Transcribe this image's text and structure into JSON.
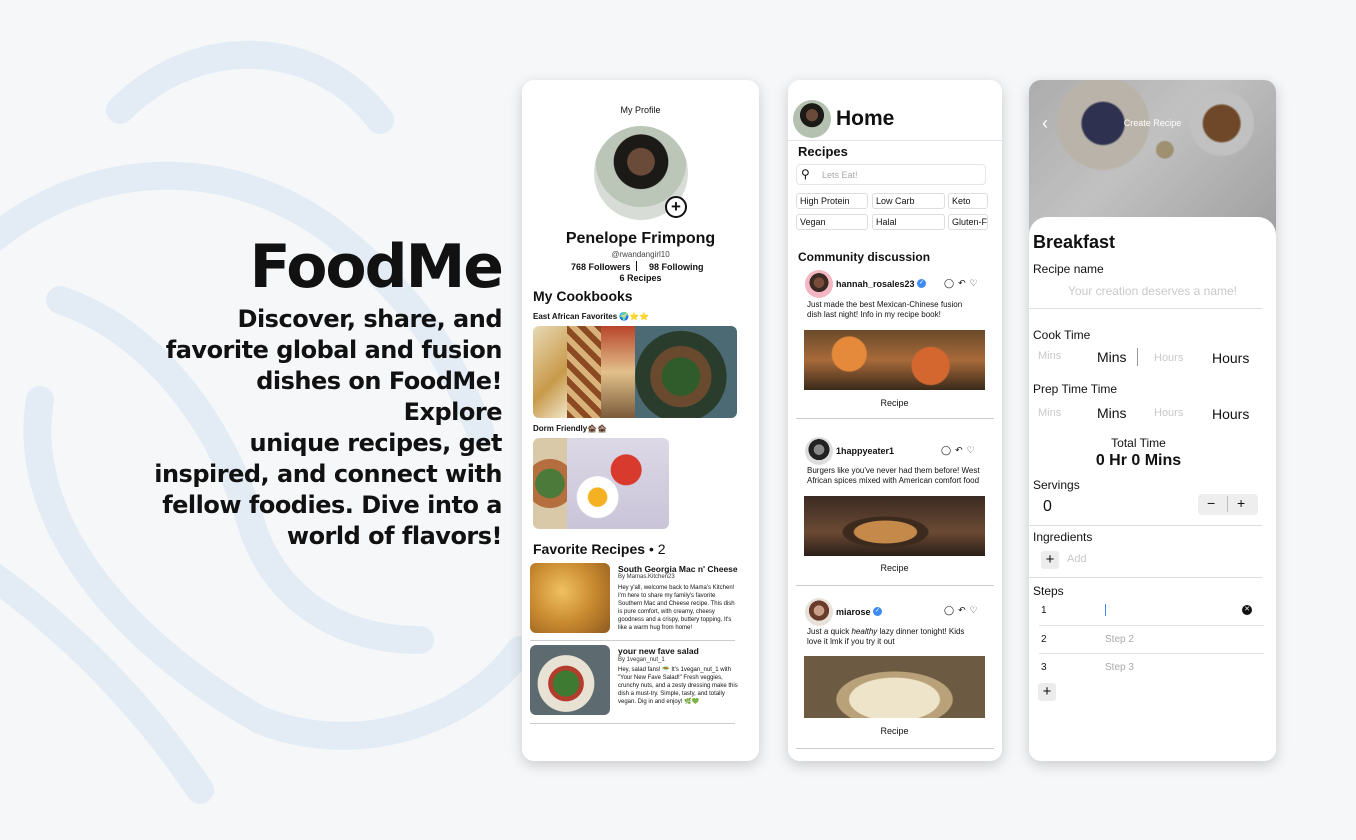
{
  "hero": {
    "title": "FoodMe",
    "tagline_lines": [
      "Discover, share, and",
      "favorite global and fusion",
      "dishes on FoodMe! Explore",
      "unique recipes, get",
      "inspired, and connect with",
      "fellow foodies. Dive into a",
      "world of flavors!"
    ]
  },
  "profile": {
    "header": "My Profile",
    "add_icon": "plus-circle-icon",
    "name": "Penelope Frimpong",
    "handle": "@rwandangirl10",
    "followers": "768 Followers",
    "following": "98 Following",
    "recipes": "6 Recipes",
    "cookbooks_title": "My Cookbooks",
    "cookbook_1": "East African Favorites 🌍⭐⭐",
    "cookbook_2": "Dorm Friendly🏚️🏚️",
    "favorites_title": "Favorite Recipes",
    "favorites_sep": "•",
    "favorites_count": "2",
    "fav_1": {
      "title": "South Georgia Mac n' Cheese",
      "author": "By Mamas.Kitchen23",
      "desc": "Hey y'all, welcome back to Mama's Kitchen! I'm here to share my family's favorite Southern Mac and Cheese recipe. This dish is pure comfort, with creamy, cheesy goodness and a crispy, buttery topping. It's like a warm hug from home!"
    },
    "fav_2": {
      "title": "your new fave salad",
      "author": "By 1vegan_nut_1",
      "desc": "Hey, salad fans! 🥗 It's 1vegan_nut_1 with \"Your New Fave Salad!\" Fresh veggies, crunchy nuts, and a zesty dressing make this dish a must-try. Simple, tasty, and totally vegan. Dig in and enjoy! 🌿💚"
    }
  },
  "home": {
    "title": "Home",
    "recipes_title": "Recipes",
    "search_placeholder": "Lets Eat!",
    "chips": [
      "High Protein",
      "Low Carb",
      "Keto",
      "Vegan",
      "Halal",
      "Gluten-F"
    ],
    "community_title": "Community discussion",
    "posts": [
      {
        "user": "hannah_rosales23",
        "verified": true,
        "text": "Just made the best Mexican-Chinese fusion dish last night! Info in my recipe book!",
        "button": "Recipe"
      },
      {
        "user": "1happyeater1",
        "verified": false,
        "text": "Burgers like you've never had them before! West African spices mixed with American comfort food",
        "button": "Recipe"
      },
      {
        "user": "miarose",
        "verified": true,
        "text_before": "Just a quick ",
        "text_em": "healthy",
        "text_after": " lazy dinner tonight! Kids love it lmk if you try it out",
        "button": "Recipe"
      }
    ],
    "post_icons": [
      "comment-icon",
      "reply-icon",
      "heart-icon"
    ]
  },
  "create": {
    "header": "Create Recipe",
    "back_icon": "chevron-left-icon",
    "section": "Breakfast",
    "recipe_name_label": "Recipe name",
    "recipe_name_placeholder": "Your creation deserves a name!",
    "cook_time_label": "Cook Time",
    "prep_time_label": "Prep Time Time",
    "mins_placeholder": "Mins",
    "mins_label": "Mins",
    "hours_placeholder": "Hours",
    "hours_label": "Hours",
    "total_label": "Total Time",
    "total_value": "0 Hr 0 Mins",
    "servings_label": "Servings",
    "servings_value": "0",
    "minus": "−",
    "plus": "+",
    "ingredients_label": "Ingredients",
    "ingredients_placeholder": "Add",
    "steps_label": "Steps",
    "steps": [
      {
        "num": "1",
        "placeholder": ""
      },
      {
        "num": "2",
        "placeholder": "Step 2"
      },
      {
        "num": "3",
        "placeholder": "Step 3"
      }
    ]
  }
}
